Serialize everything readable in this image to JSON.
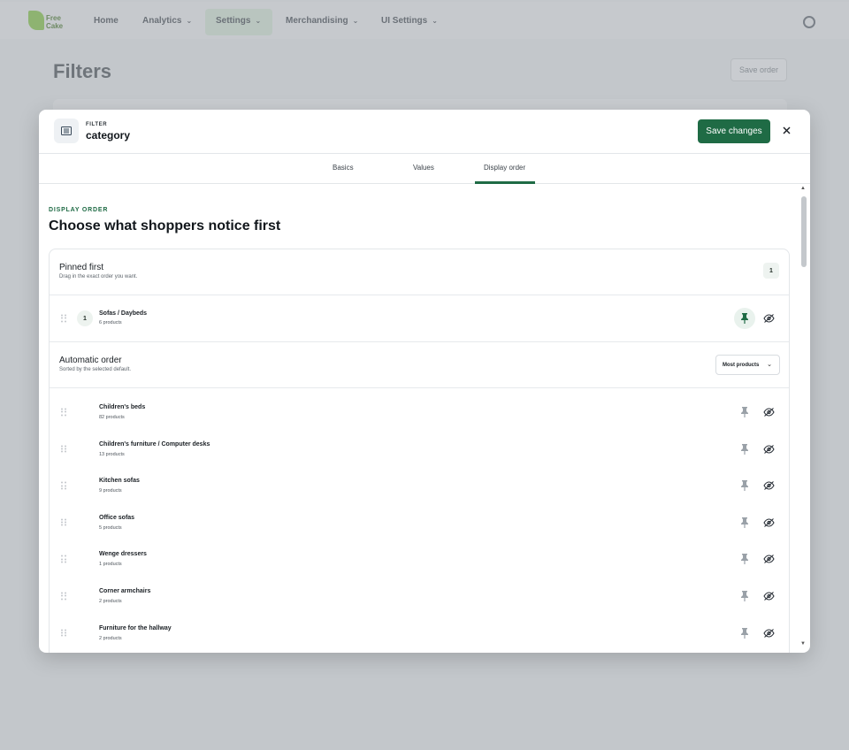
{
  "nav": {
    "logo_text": "Free\nCake",
    "items": [
      {
        "label": "Home"
      },
      {
        "label": "Analytics"
      },
      {
        "label": "Settings"
      },
      {
        "label": "Merchandising"
      },
      {
        "label": "UI Settings"
      }
    ]
  },
  "page": {
    "title": "Filters",
    "save_order_label": "Save order"
  },
  "modal": {
    "kicker": "FILTER",
    "title": "category",
    "save_label": "Save changes",
    "tabs": [
      {
        "label": "Basics"
      },
      {
        "label": "Values"
      },
      {
        "label": "Display order"
      }
    ],
    "active_tab": "Display order",
    "section_kicker": "DISPLAY ORDER",
    "headline": "Choose what shoppers notice first",
    "pinned": {
      "title": "Pinned first",
      "subtitle": "Drag in the exact order you want.",
      "count": "1",
      "items": [
        {
          "position": "1",
          "name": "Sofas / Daybeds",
          "count": "6 products"
        }
      ]
    },
    "automatic": {
      "title": "Automatic order",
      "subtitle": "Sorted by the selected default.",
      "sort_value": "Most products",
      "items": [
        {
          "name": "Children's beds",
          "count": "82 products"
        },
        {
          "name": "Children's furniture / Computer desks",
          "count": "13 products"
        },
        {
          "name": "Kitchen sofas",
          "count": "9 products"
        },
        {
          "name": "Office sofas",
          "count": "5 products"
        },
        {
          "name": "Wenge dressers",
          "count": "1 products"
        },
        {
          "name": "Corner armchairs",
          "count": "2 products"
        },
        {
          "name": "Furniture for the hallway",
          "count": "2 products"
        }
      ]
    }
  },
  "colors": {
    "accent": "#1f6b45",
    "overlay": "#c3c7cb"
  }
}
